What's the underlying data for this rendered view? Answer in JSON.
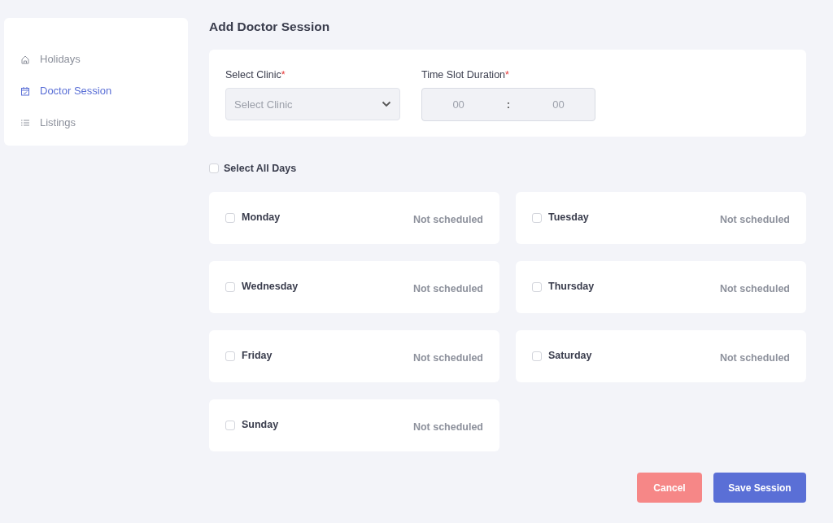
{
  "sidebar": {
    "items": [
      {
        "label": "Holidays",
        "kind": "home",
        "selected": false
      },
      {
        "label": "Doctor Session",
        "kind": "calendar",
        "selected": true
      },
      {
        "label": "Listings",
        "kind": "list",
        "selected": false
      }
    ]
  },
  "page_title": "Add Doctor Session",
  "form": {
    "clinic": {
      "label": "Select Clinic",
      "required_mark": "*",
      "placeholder": "Select Clinic"
    },
    "duration": {
      "label": "Time Slot Duration",
      "required_mark": "*",
      "hours_placeholder": "00",
      "separator": ":",
      "minutes_placeholder": "00"
    }
  },
  "select_all": {
    "label": "Select All Days",
    "checked": false
  },
  "days": [
    {
      "name": "Monday",
      "checked": false,
      "status": "Not scheduled"
    },
    {
      "name": "Tuesday",
      "checked": false,
      "status": "Not scheduled"
    },
    {
      "name": "Wednesday",
      "checked": false,
      "status": "Not scheduled"
    },
    {
      "name": "Thursday",
      "checked": false,
      "status": "Not scheduled"
    },
    {
      "name": "Friday",
      "checked": false,
      "status": "Not scheduled"
    },
    {
      "name": "Saturday",
      "checked": false,
      "status": "Not scheduled"
    },
    {
      "name": "Sunday",
      "checked": false,
      "status": "Not scheduled"
    }
  ],
  "buttons": [
    {
      "label": "Cancel",
      "kind": "cancel"
    },
    {
      "label": "Save Session",
      "kind": "save"
    }
  ]
}
